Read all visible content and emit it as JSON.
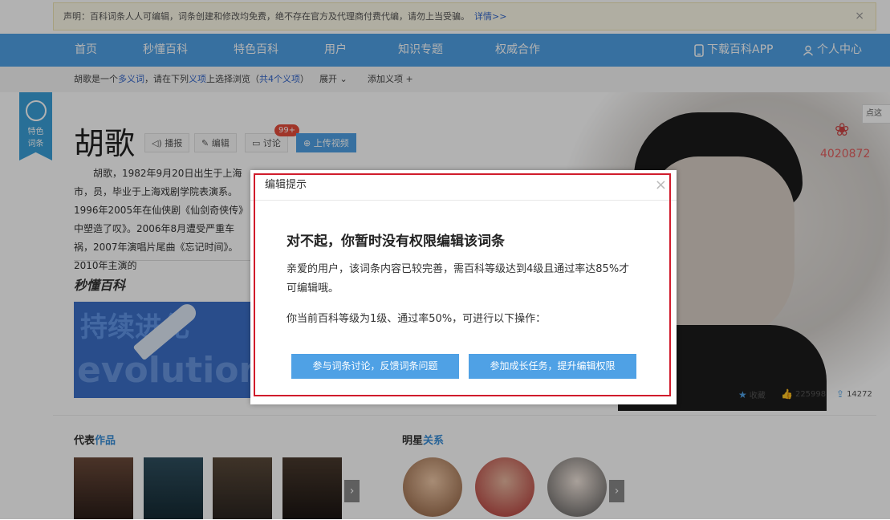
{
  "notice": {
    "text": "声明：百科词条人人可编辑，词条创建和修改均免费，绝不存在官方及代理商付费代编，请勿上当受骗。",
    "link": "详情>>",
    "close": "×"
  },
  "nav": {
    "items": [
      "首页",
      "秒懂百科",
      "特色百科",
      "用户",
      "知识专题",
      "权威合作"
    ],
    "download_app": "下载百科APP",
    "personal_center": "个人中心"
  },
  "subbar": {
    "prefix": "胡歌",
    "middle1": "是一个",
    "polysemy": "多义词",
    "middle2": "，请在下列",
    "meanings": "义项",
    "middle3": "上选择浏览（",
    "count": "共4个义项",
    "suffix": "）",
    "expand": "展开",
    "add_meaning": "添加义项"
  },
  "ribbon": {
    "line1": "特色",
    "line2": "词条"
  },
  "entry": {
    "title": "胡歌",
    "buttons": {
      "broadcast": "播报",
      "edit": "编辑",
      "discuss": "讨论",
      "upload_video": "上传视频"
    },
    "discuss_badge": "99+",
    "summary": "　　胡歌，1982年9月20日出生于上海市，员，毕业于上海戏剧学院表演系。1996年2005年在仙侠剧《仙剑奇侠传》中塑造了叹》。2006年8月遭受严重车祸，2007年演唱片尾曲《忘记时间》。2010年主演的",
    "brand": "秒懂百科"
  },
  "banner": {
    "t1": "持续进化",
    "t2": "evolution"
  },
  "side": {
    "heat": "4020872",
    "click_hint": "点这"
  },
  "stats": {
    "collect": "收藏",
    "likes": "225998",
    "shares": "14272"
  },
  "sections": {
    "works_title_a": "代表",
    "works_title_b": "作品",
    "relations_title_a": "明星",
    "relations_title_b": "关系"
  },
  "dialog": {
    "title": "编辑提示",
    "close": "×",
    "heading": "对不起，你暂时没有权限编辑该词条",
    "paragraph1": "亲爱的用户，该词条内容已较完善，需百科等级达到4级且通过率达85%才可编辑哦。",
    "paragraph2": "你当前百科等级为1级、通过率50%，可进行以下操作：",
    "button_discuss": "参与词条讨论，反馈词条问题",
    "button_task": "参加成长任务，提升编辑权限"
  },
  "colors": {
    "nav_blue": "#4fa1e5",
    "highlight_red": "#d01c2c",
    "heat_red": "#e35f5f"
  }
}
